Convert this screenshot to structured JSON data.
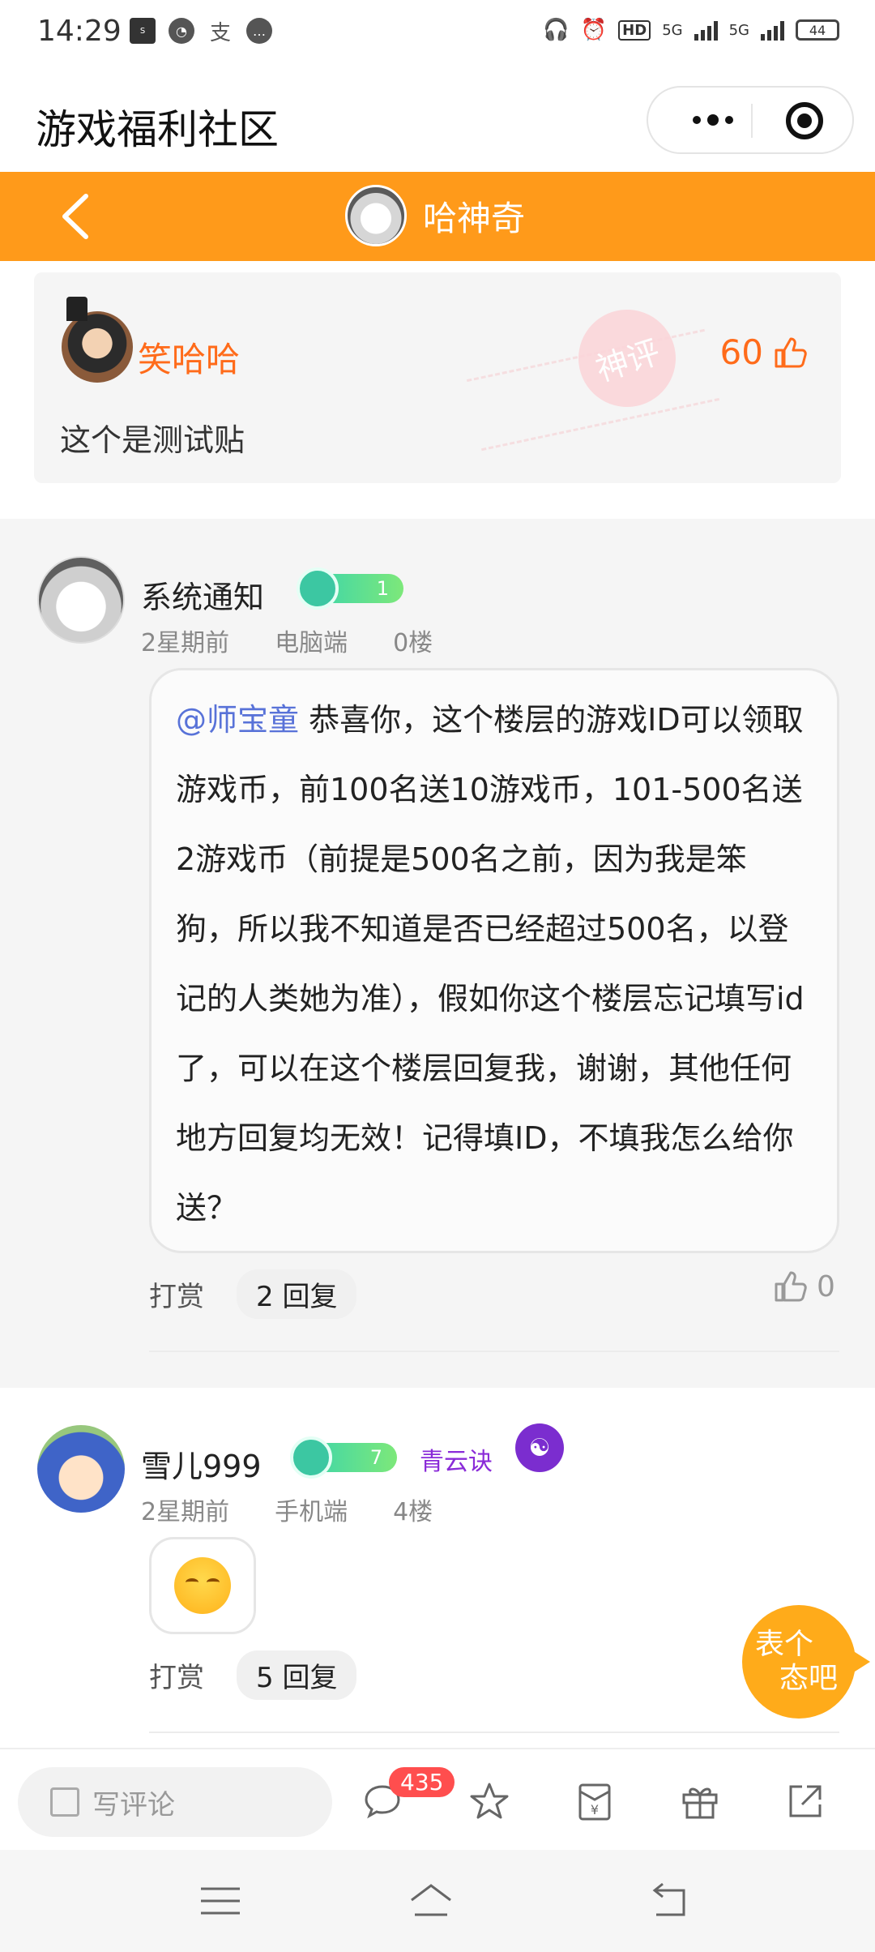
{
  "status_bar": {
    "time": "14:29",
    "network_labels": [
      "HD",
      "5G",
      "5G"
    ],
    "battery": "44"
  },
  "titlebar": {
    "title": "游戏福利社区"
  },
  "header": {
    "username": "哈神奇"
  },
  "quoted_post": {
    "author": "笑哈哈",
    "stamp_text": "神评",
    "likes": "60",
    "text": "这个是测试贴"
  },
  "comments": [
    {
      "author": "系统通知",
      "level": "1",
      "time": "2星期前",
      "device": "电脑端",
      "floor": "0楼",
      "mention": "@师宝童",
      "text": "恭喜你，这个楼层的游戏ID可以领取游戏币，前100名送10游戏币，101-500名送2游戏币（前提是500名之前，因为我是笨狗，所以我不知道是否已经超过500名，以登记的人类她为准），假如你这个楼层忘记填写id了，可以在这个楼层回复我，谢谢，其他任何地方回复均无效！记得填ID，不填我怎么给你送？",
      "reward_label": "打赏",
      "reply_label": "2 回复",
      "likes": "0"
    },
    {
      "author": "雪儿999",
      "level": "7",
      "title_tag": "青云诀",
      "time": "2星期前",
      "device": "手机端",
      "floor": "4楼",
      "reward_label": "打赏",
      "reply_label": "5 回复"
    }
  ],
  "float_button": {
    "line1": "表个",
    "line2": "态吧"
  },
  "bottom_bar": {
    "comment_placeholder": "写评论",
    "comment_count": "435"
  }
}
